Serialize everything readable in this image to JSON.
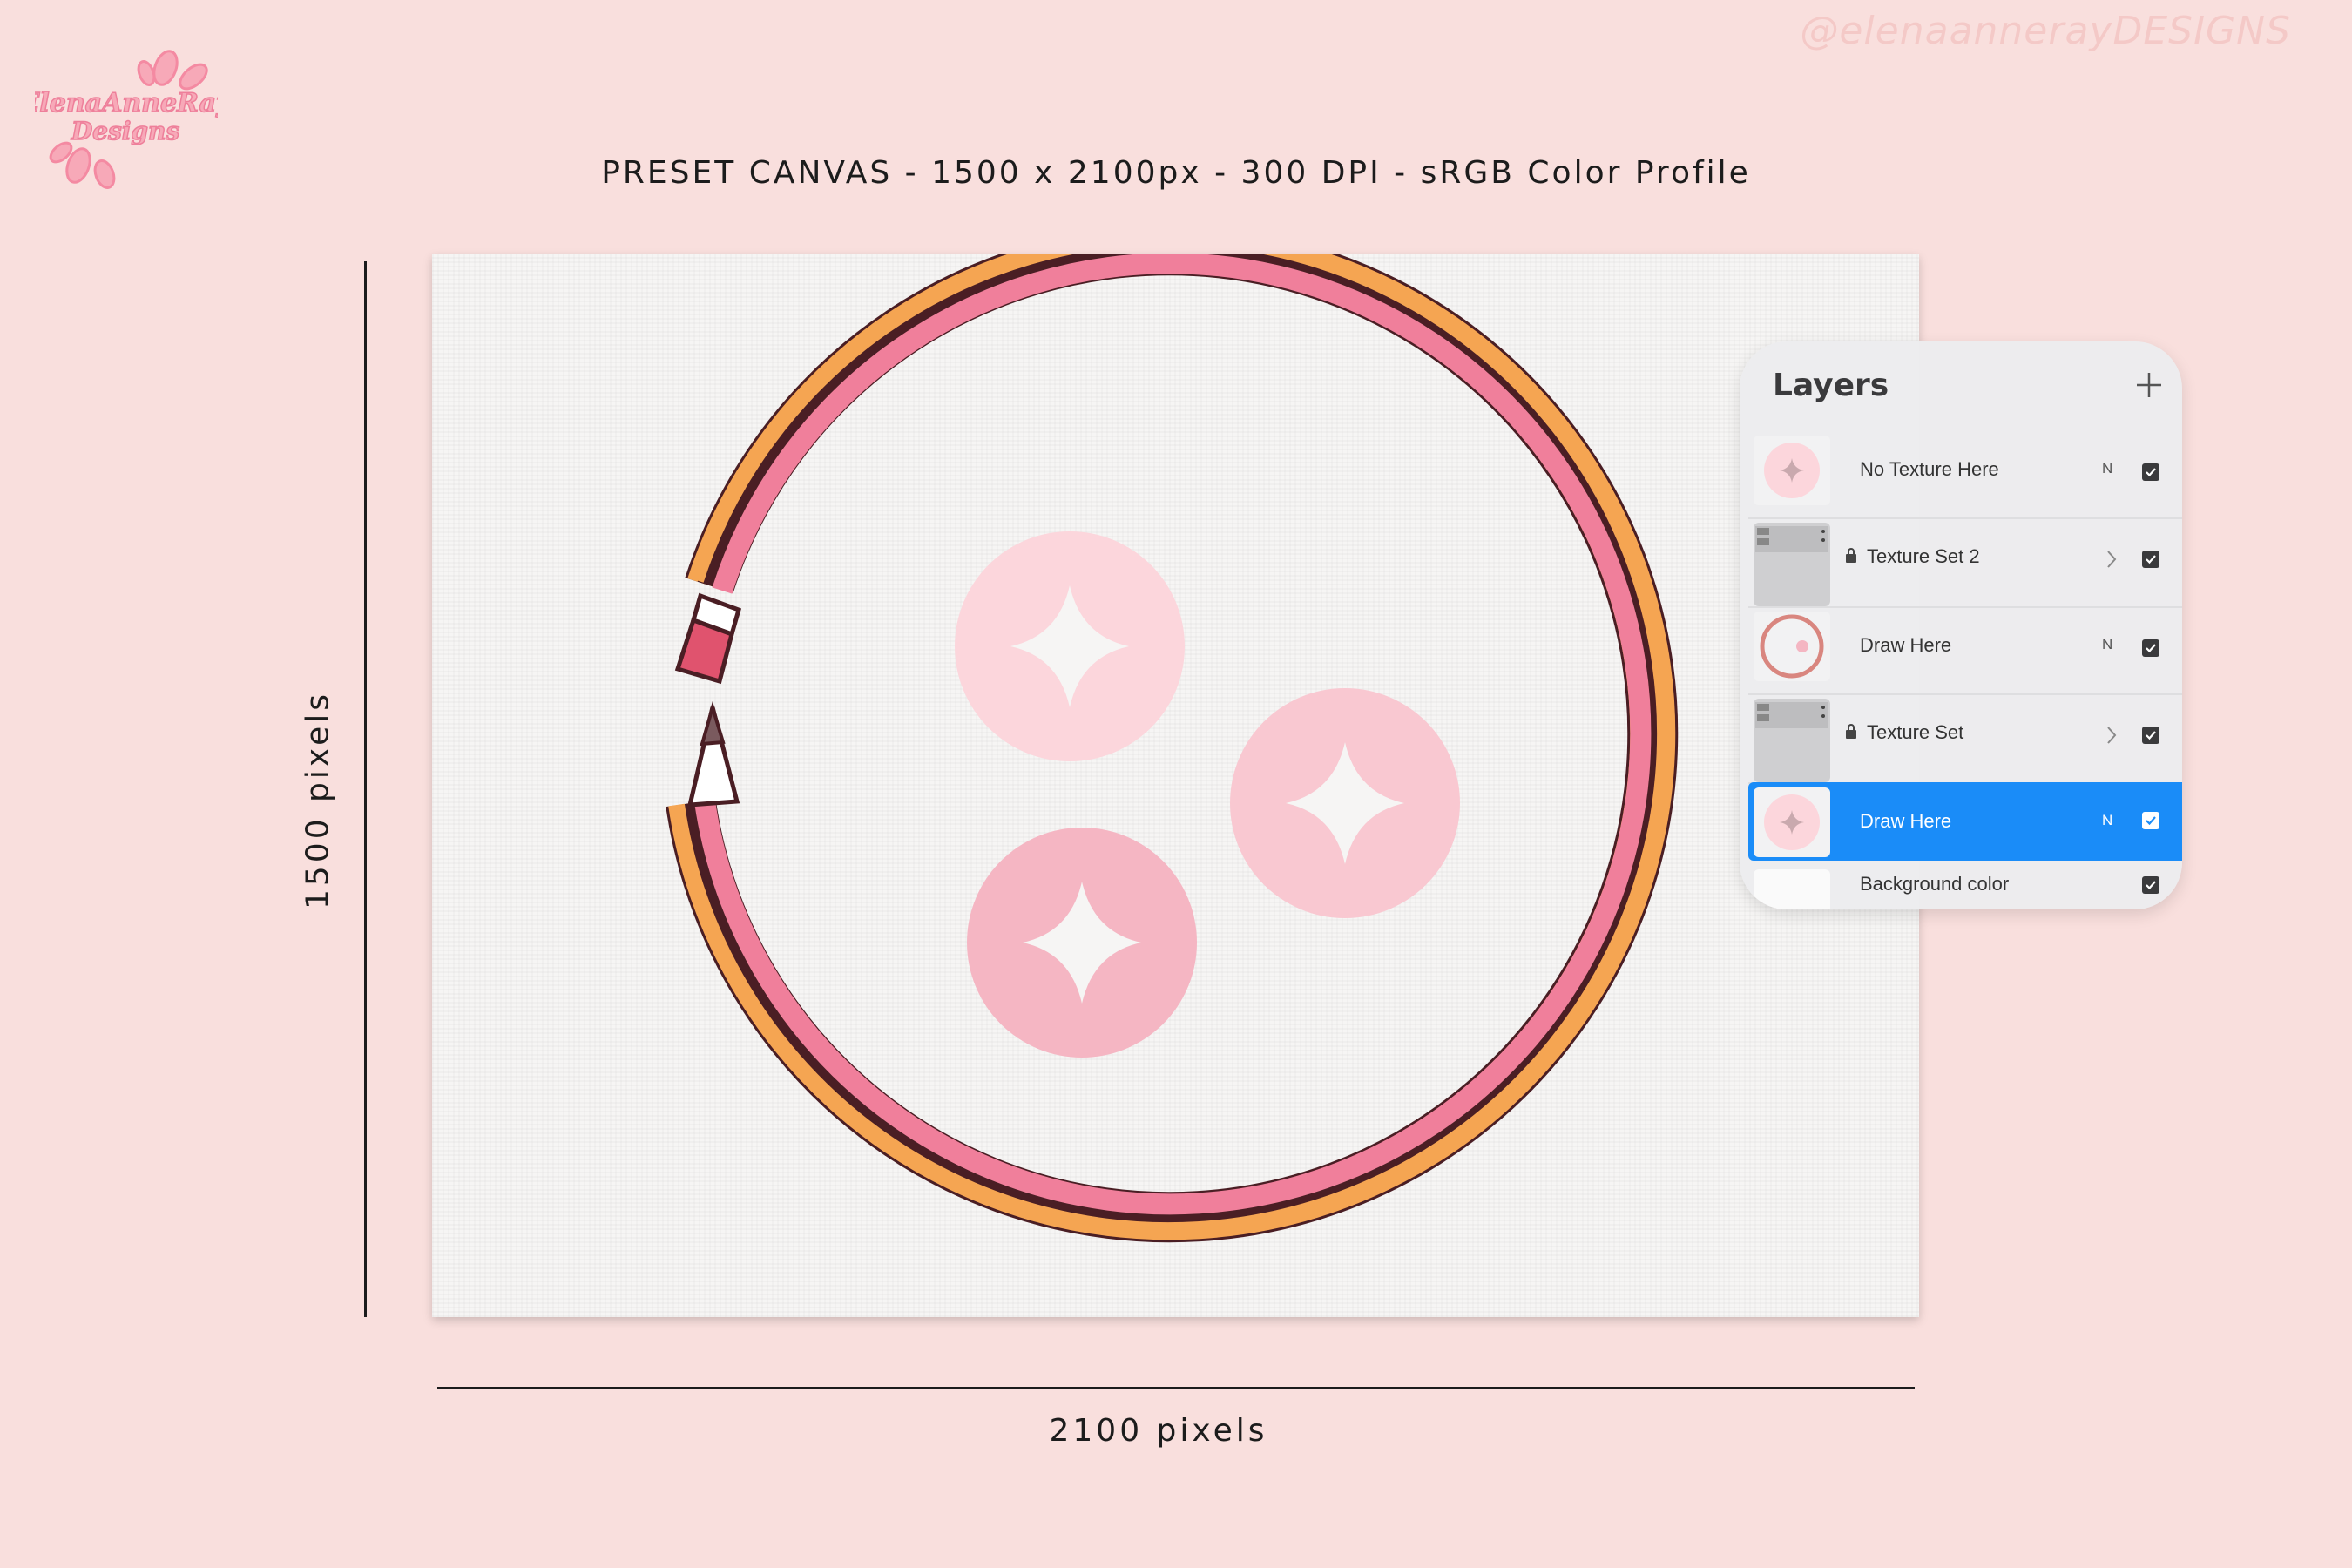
{
  "header": {
    "title": "PRESET CANVAS - 1500 x 2100px - 300 DPI - sRGB Color Profile",
    "watermark": "@elenaannerayDESIGNS",
    "logo_text": "ElenaAnneRay Designs"
  },
  "dimensions": {
    "height_label": "1500 pixels",
    "width_label": "2100 pixels"
  },
  "layers_panel": {
    "title": "Layers",
    "add_icon": "plus-icon",
    "layers": [
      {
        "name": "No Texture Here",
        "blend": "N",
        "visible": true,
        "locked": false,
        "group": false,
        "selected": false
      },
      {
        "name": "Texture Set 2",
        "blend": "",
        "visible": true,
        "locked": true,
        "group": true,
        "selected": false
      },
      {
        "name": "Draw Here",
        "blend": "N",
        "visible": true,
        "locked": false,
        "group": false,
        "selected": false
      },
      {
        "name": "Texture Set",
        "blend": "",
        "visible": true,
        "locked": true,
        "group": true,
        "selected": false
      },
      {
        "name": "Draw Here",
        "blend": "N",
        "visible": true,
        "locked": false,
        "group": false,
        "selected": true
      },
      {
        "name": "Background color",
        "blend": "",
        "visible": true,
        "locked": false,
        "group": false,
        "selected": false
      }
    ]
  },
  "colors": {
    "background": "#f9dfdd",
    "selection": "#1a8cf8",
    "pencil_orange": "#f5a552",
    "pencil_pink": "#f07f9b",
    "outline": "#4a1e24"
  }
}
